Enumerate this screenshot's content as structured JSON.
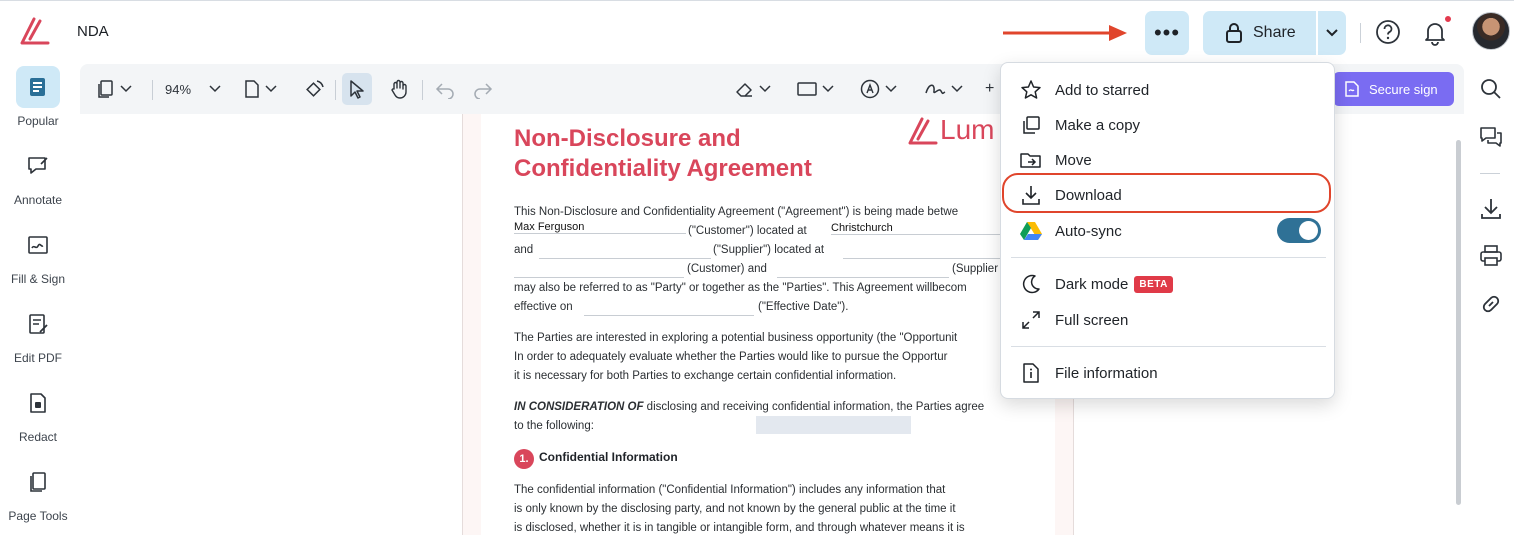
{
  "app": {
    "doc_title": "NDA"
  },
  "header": {
    "more_label": "•••",
    "share_label": "Share",
    "colors": {
      "brand": "#d9465b",
      "button_bg": "#cfe9f7",
      "accent_arrow": "#e0452c"
    }
  },
  "sidebar": {
    "items": [
      {
        "label": "Popular",
        "icon": "popular-icon"
      },
      {
        "label": "Annotate",
        "icon": "annotate-icon"
      },
      {
        "label": "Fill & Sign",
        "icon": "fill-sign-icon"
      },
      {
        "label": "Edit PDF",
        "icon": "edit-pdf-icon"
      },
      {
        "label": "Redact",
        "icon": "redact-icon"
      },
      {
        "label": "Page Tools",
        "icon": "page-tools-icon"
      }
    ]
  },
  "toolbar": {
    "zoom": "94%",
    "secure_sign": "Secure sign"
  },
  "menu": {
    "items": [
      {
        "label": "Add to starred",
        "icon": "star-icon"
      },
      {
        "label": "Make a copy",
        "icon": "copy-icon"
      },
      {
        "label": "Move",
        "icon": "folder-move-icon"
      },
      {
        "label": "Download",
        "icon": "download-icon"
      },
      {
        "label": "Auto-sync",
        "icon": "google-drive-icon"
      },
      {
        "label": "Dark mode",
        "icon": "moon-icon",
        "badge": "BETA"
      },
      {
        "label": "Full screen",
        "icon": "fullscreen-icon"
      },
      {
        "label": "File information",
        "icon": "file-info-icon"
      }
    ],
    "auto_sync_on": true
  },
  "pdf": {
    "title_line1": "Non-Disclosure and",
    "title_line2": "Confidentiality Agreement",
    "logo": "Lum",
    "lines": [
      "This Non-Disclosure and Confidentiality Agreement (\"Agreement\") is being made betwe",
      "(\"Customer\") located at",
      "(\"Supplier\") located at",
      "(Customer) and",
      "(Supplier",
      "may also be referred to as \"Party\" or together as the \"Parties\". This Agreement willbecom",
      "(\"Effective Date\").",
      "The Parties are interested in exploring a potential business opportunity (the \"Opportunit",
      "In order to adequately evaluate whether the Parties would like to pursue the Opportur",
      "it is necessary for both Parties to exchange certain confidential information.",
      "IN CONSIDERATION OF",
      " disclosing and receiving confidential information, the Parties agree",
      "to the following:",
      "The confidential information (\"Confidential Information\") includes any information that",
      "is only known by the disclosing party, and not known by the general public at the time it",
      "is disclosed, whether it is in tangible or intangible form, and through whatever means it is"
    ],
    "and_label": "and",
    "effective_on": "effective on",
    "customer_name": "Max Ferguson",
    "customer_city": "Christchurch",
    "section_num": "1.",
    "section_title": "Confidential Information"
  }
}
